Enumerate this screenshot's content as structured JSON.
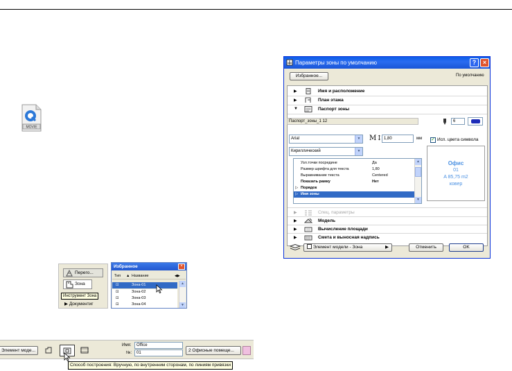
{
  "dialog": {
    "title": "Параметры зоны по умолчанию",
    "favorites_button": "Избранное...",
    "default_label": "По умолчанию",
    "sections": {
      "name_position": "Имя и расположение",
      "floor_plan": "План этажа",
      "zone_stamp": "Паспорт зоны",
      "special_params": "Спец. параметры",
      "model": "Модель",
      "area_calc": "Вычисление площади",
      "listing_label": "Смета и выносная надпись"
    },
    "stamp_name": "Паспорт_зоны_1 12",
    "pen_number": "6",
    "font": "Arial",
    "script": "Кириллический",
    "font_size": "1,80",
    "unit": "мм",
    "use_symbol_color_label": "Исп. цвета символа",
    "params": [
      {
        "key": "Узл.точки посредине",
        "value": "Да"
      },
      {
        "key": "Размер шрифта для текста",
        "value": "1,80"
      },
      {
        "key": "Выравнивание текста",
        "value": "Centered"
      },
      {
        "key": "Показать рамку",
        "value": "Нет"
      },
      {
        "key": "Порядок",
        "value": ""
      },
      {
        "key": "Имя зоны",
        "value": ""
      }
    ],
    "preview": {
      "line1": "Офис",
      "line2": "01",
      "line3": "A  85,75 m2",
      "line4": "ковер"
    },
    "model_element_select": "Элемент модели - Зона",
    "cancel_button": "Отменить",
    "ok_button": "OK"
  },
  "toolbox": {
    "tool1": "Перего...",
    "tool2": "Зона",
    "tooltip": "Инструмент Зона",
    "tool3": "Документиг"
  },
  "favorites": {
    "title": "Избранное",
    "col_type": "Тип",
    "col_name": "Название",
    "rows": [
      "Зона-01",
      "Зона-02",
      "Зона-03",
      "Зона-04"
    ]
  },
  "infobar": {
    "element_select": "Элемент моде...",
    "name_label": "Имя:",
    "name_value": "Office",
    "number_label": "№:",
    "number_value": "01",
    "category_select": "2  Офисные помеще...",
    "tooltip": "Способ построения: Вручную, по внутренним сторонам, по линиям привязки"
  },
  "colors": {
    "title_blue": "#0a5ce8",
    "selection": "#316ac5",
    "preview_text": "#4a90e2"
  }
}
